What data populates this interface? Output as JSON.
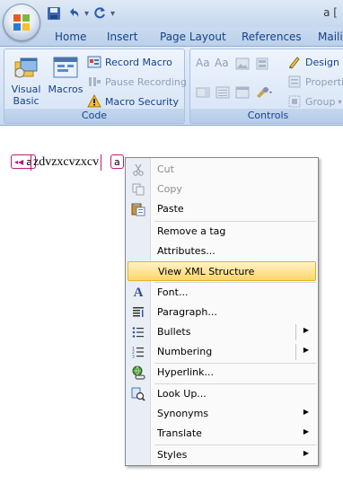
{
  "titlebar": {
    "title_fragment": "a ["
  },
  "tabs": [
    "Home",
    "Insert",
    "Page Layout",
    "References",
    "Mailin"
  ],
  "ribbon": {
    "code_group": {
      "label": "Code",
      "visual_basic": [
        "Visual",
        "Basic"
      ],
      "macros": "Macros",
      "record_macro": "Record Macro",
      "pause_recording": "Pause Recording",
      "macro_security": "Macro Security"
    },
    "controls_group": {
      "label": "Controls",
      "design": "Design",
      "properties": "Properti",
      "group": "Group"
    }
  },
  "document": {
    "tag_open": "a",
    "text": "zdvzxcvzxcv",
    "tag_close": "a"
  },
  "context_menu": {
    "items": [
      {
        "label": "Cut",
        "icon": "scissors-icon",
        "disabled": true
      },
      {
        "label": "Copy",
        "icon": "copy-icon",
        "disabled": true
      },
      {
        "label": "Paste",
        "icon": "paste-icon",
        "disabled": false
      },
      {
        "label": "Remove a tag",
        "icon": "",
        "disabled": false
      },
      {
        "label": "Attributes...",
        "icon": "",
        "disabled": false
      },
      {
        "label": "View XML Structure",
        "icon": "",
        "disabled": false,
        "highlight": true
      },
      {
        "label": "Font...",
        "icon": "font-icon",
        "disabled": false
      },
      {
        "label": "Paragraph...",
        "icon": "paragraph-icon",
        "disabled": false
      },
      {
        "label": "Bullets",
        "icon": "bullets-icon",
        "disabled": false,
        "submenu": true
      },
      {
        "label": "Numbering",
        "icon": "numbering-icon",
        "disabled": false,
        "submenu": true
      },
      {
        "label": "Hyperlink...",
        "icon": "hyperlink-icon",
        "disabled": false
      },
      {
        "label": "Look Up...",
        "icon": "lookup-icon",
        "disabled": false
      },
      {
        "label": "Synonyms",
        "icon": "",
        "disabled": false,
        "submenu": true
      },
      {
        "label": "Translate",
        "icon": "",
        "disabled": false,
        "submenu": true
      },
      {
        "label": "Styles",
        "icon": "",
        "disabled": false,
        "submenu": true
      }
    ]
  },
  "colors": {
    "highlight": "#ffd56a",
    "tag_border": "#c0187a",
    "ribbon_text": "#15428b"
  }
}
